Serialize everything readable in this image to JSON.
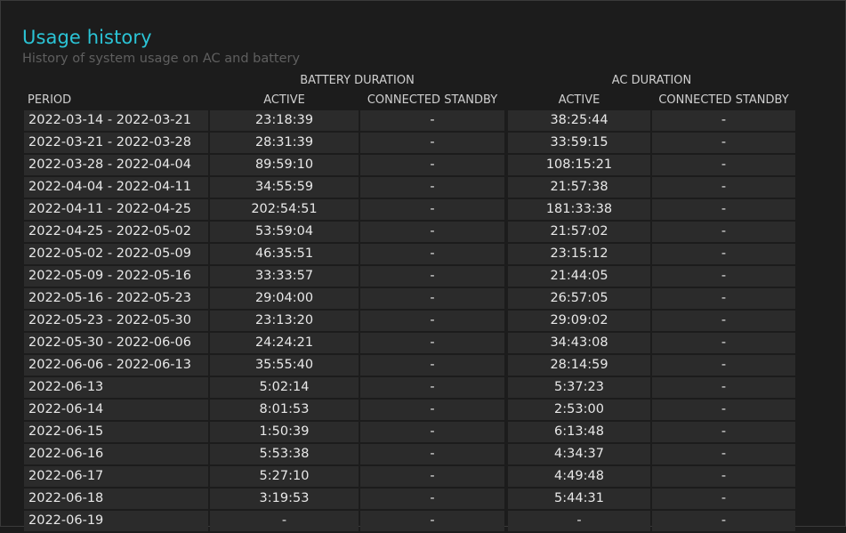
{
  "title": "Usage history",
  "subtitle": "History of system usage on AC and battery",
  "groups": {
    "battery": "BATTERY DURATION",
    "ac": "AC DURATION"
  },
  "columns": {
    "period": "PERIOD",
    "battery_active": "ACTIVE",
    "battery_standby": "CONNECTED STANDBY",
    "ac_active": "ACTIVE",
    "ac_standby": "CONNECTED STANDBY"
  },
  "rows": [
    {
      "period": "2022-03-14 - 2022-03-21",
      "battery_active": "23:18:39",
      "battery_standby": "-",
      "ac_active": "38:25:44",
      "ac_standby": "-"
    },
    {
      "period": "2022-03-21 - 2022-03-28",
      "battery_active": "28:31:39",
      "battery_standby": "-",
      "ac_active": "33:59:15",
      "ac_standby": "-"
    },
    {
      "period": "2022-03-28 - 2022-04-04",
      "battery_active": "89:59:10",
      "battery_standby": "-",
      "ac_active": "108:15:21",
      "ac_standby": "-"
    },
    {
      "period": "2022-04-04 - 2022-04-11",
      "battery_active": "34:55:59",
      "battery_standby": "-",
      "ac_active": "21:57:38",
      "ac_standby": "-"
    },
    {
      "period": "2022-04-11 - 2022-04-25",
      "battery_active": "202:54:51",
      "battery_standby": "-",
      "ac_active": "181:33:38",
      "ac_standby": "-"
    },
    {
      "period": "2022-04-25 - 2022-05-02",
      "battery_active": "53:59:04",
      "battery_standby": "-",
      "ac_active": "21:57:02",
      "ac_standby": "-"
    },
    {
      "period": "2022-05-02 - 2022-05-09",
      "battery_active": "46:35:51",
      "battery_standby": "-",
      "ac_active": "23:15:12",
      "ac_standby": "-"
    },
    {
      "period": "2022-05-09 - 2022-05-16",
      "battery_active": "33:33:57",
      "battery_standby": "-",
      "ac_active": "21:44:05",
      "ac_standby": "-"
    },
    {
      "period": "2022-05-16 - 2022-05-23",
      "battery_active": "29:04:00",
      "battery_standby": "-",
      "ac_active": "26:57:05",
      "ac_standby": "-"
    },
    {
      "period": "2022-05-23 - 2022-05-30",
      "battery_active": "23:13:20",
      "battery_standby": "-",
      "ac_active": "29:09:02",
      "ac_standby": "-"
    },
    {
      "period": "2022-05-30 - 2022-06-06",
      "battery_active": "24:24:21",
      "battery_standby": "-",
      "ac_active": "34:43:08",
      "ac_standby": "-"
    },
    {
      "period": "2022-06-06 - 2022-06-13",
      "battery_active": "35:55:40",
      "battery_standby": "-",
      "ac_active": "28:14:59",
      "ac_standby": "-"
    },
    {
      "period": "2022-06-13",
      "battery_active": "5:02:14",
      "battery_standby": "-",
      "ac_active": "5:37:23",
      "ac_standby": "-"
    },
    {
      "period": "2022-06-14",
      "battery_active": "8:01:53",
      "battery_standby": "-",
      "ac_active": "2:53:00",
      "ac_standby": "-"
    },
    {
      "period": "2022-06-15",
      "battery_active": "1:50:39",
      "battery_standby": "-",
      "ac_active": "6:13:48",
      "ac_standby": "-"
    },
    {
      "period": "2022-06-16",
      "battery_active": "5:53:38",
      "battery_standby": "-",
      "ac_active": "4:34:37",
      "ac_standby": "-"
    },
    {
      "period": "2022-06-17",
      "battery_active": "5:27:10",
      "battery_standby": "-",
      "ac_active": "4:49:48",
      "ac_standby": "-"
    },
    {
      "period": "2022-06-18",
      "battery_active": "3:19:53",
      "battery_standby": "-",
      "ac_active": "5:44:31",
      "ac_standby": "-"
    },
    {
      "period": "2022-06-19",
      "battery_active": "-",
      "battery_standby": "-",
      "ac_active": "-",
      "ac_standby": "-"
    }
  ]
}
